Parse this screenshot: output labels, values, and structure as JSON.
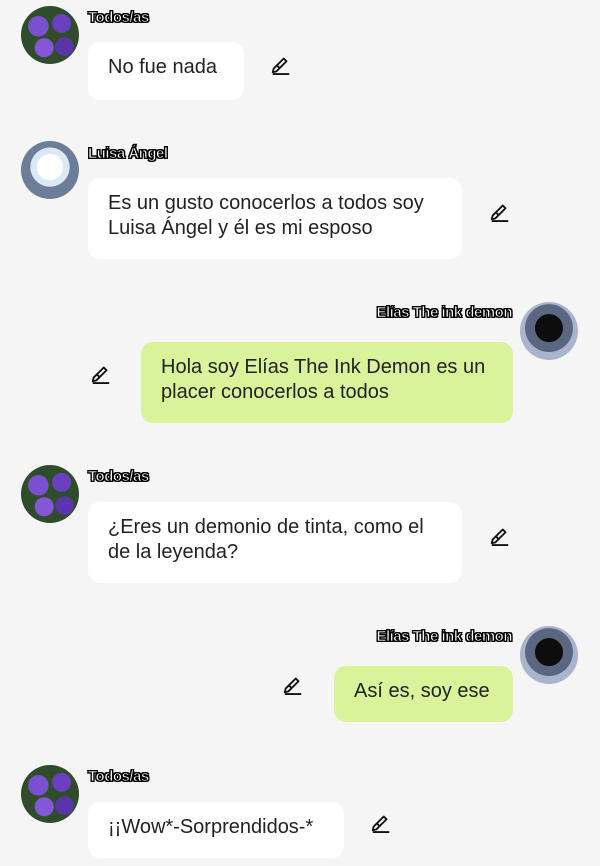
{
  "messages": [
    {
      "author": "Todos/as",
      "text": "No fue nada"
    },
    {
      "author": "Luisa Ángel",
      "text": "Es un gusto conocerlos a todos soy Luisa Ángel y él es mi esposo"
    },
    {
      "author": "Elías The ink demon",
      "text": "Hola soy Elías The Ink Demon es un placer conocerlos a todos"
    },
    {
      "author": "Todos/as",
      "text": "¿Eres un demonio de tinta, como el de la leyenda?"
    },
    {
      "author": "Elías The ink demon",
      "text": "Así es, soy ese"
    },
    {
      "author": "Todos/as",
      "text": "¡¡Wow*-Sorprendidos-*"
    }
  ],
  "colors": {
    "background": "#f5f5f5",
    "incoming_bubble": "#ffffff",
    "outgoing_bubble": "#d8f39a"
  },
  "icons": {
    "edit": "pencil-edit-icon"
  }
}
